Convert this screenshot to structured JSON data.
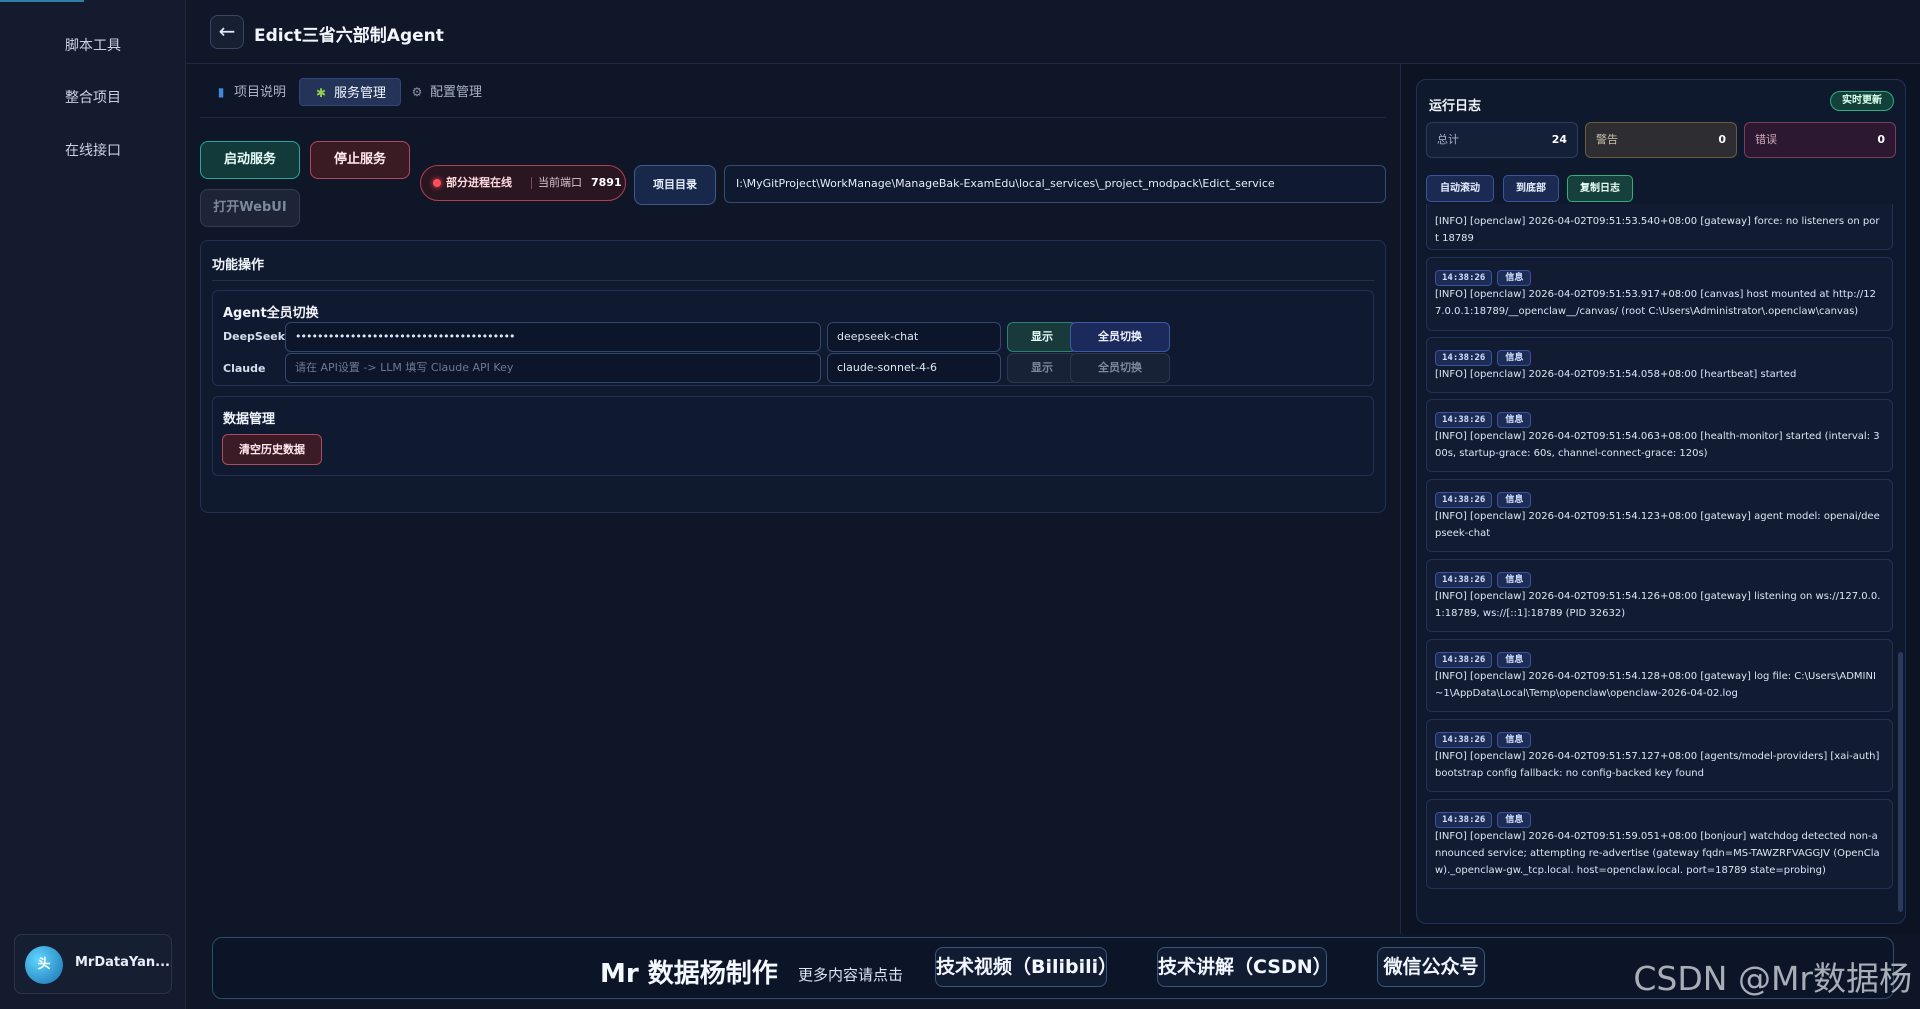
{
  "sidebar": {
    "items": [
      {
        "label": "脚本工具"
      },
      {
        "label": "整合项目"
      },
      {
        "label": "在线接口"
      }
    ],
    "user": {
      "avatar_text": "头",
      "name": "MrDataYan..."
    }
  },
  "header": {
    "back_icon": "←",
    "title": "Edict三省六部制Agent"
  },
  "tabs": [
    {
      "label": "项目说明",
      "icon": "book-icon",
      "active": false
    },
    {
      "label": "服务管理",
      "icon": "puzzle-icon",
      "active": true
    },
    {
      "label": "配置管理",
      "icon": "gear-icon",
      "active": false
    }
  ],
  "service": {
    "start_label": "启动服务",
    "stop_label": "停止服务",
    "webui_label": "打开WebUI",
    "status_text": "部分进程在线",
    "port_label": "当前端口",
    "port_value": "7891",
    "projdir_label": "项目目录",
    "path": "I:\\MyGitProject\\WorkManage\\ManageBak-ExamEdu\\local_services\\_project_modpack\\Edict_service"
  },
  "functions": {
    "title": "功能操作",
    "agent": {
      "title": "Agent全员切换",
      "rows": [
        {
          "label": "DeepSeek",
          "key_value": "••••••••••••••••••••••••••••••••••••••••",
          "key_placeholder": "",
          "model": "deepseek-chat",
          "show_label": "显示",
          "switch_label": "全员切换",
          "enabled": true
        },
        {
          "label": "Claude",
          "key_value": "",
          "key_placeholder": "请在 API设置 -> LLM 填写 Claude API Key",
          "model": "claude-sonnet-4-6",
          "show_label": "显示",
          "switch_label": "全员切换",
          "enabled": false
        }
      ]
    },
    "data": {
      "title": "数据管理",
      "clear_label": "清空历史数据"
    }
  },
  "log": {
    "title": "运行日志",
    "live_badge": "实时更新",
    "stats": {
      "total_label": "总计",
      "total": "24",
      "warn_label": "警告",
      "warn": "0",
      "error_label": "错误",
      "error": "0"
    },
    "buttons": {
      "auto_scroll": "自动滚动",
      "to_bottom": "到底部",
      "copy": "复制日志"
    },
    "entries": [
      {
        "time": "",
        "level": "",
        "msg": "[INFO] [openclaw] 2026-04-02T09:51:53.540+08:00 [gateway] force: no listeners on port 18789"
      },
      {
        "time": "14:38:26",
        "level": "信息",
        "msg": "[INFO] [openclaw] 2026-04-02T09:51:53.917+08:00 [canvas] host mounted at http://127.0.0.1:18789/__openclaw__/canvas/ (root C:\\Users\\Administrator\\.openclaw\\canvas)"
      },
      {
        "time": "14:38:26",
        "level": "信息",
        "msg": "[INFO] [openclaw] 2026-04-02T09:51:54.058+08:00 [heartbeat] started"
      },
      {
        "time": "14:38:26",
        "level": "信息",
        "msg": "[INFO] [openclaw] 2026-04-02T09:51:54.063+08:00 [health-monitor] started (interval: 300s, startup-grace: 60s, channel-connect-grace: 120s)"
      },
      {
        "time": "14:38:26",
        "level": "信息",
        "msg": "[INFO] [openclaw] 2026-04-02T09:51:54.123+08:00 [gateway] agent model: openai/deepseek-chat"
      },
      {
        "time": "14:38:26",
        "level": "信息",
        "msg": "[INFO] [openclaw] 2026-04-02T09:51:54.126+08:00 [gateway] listening on ws://127.0.0.1:18789, ws://[::1]:18789 (PID 32632)"
      },
      {
        "time": "14:38:26",
        "level": "信息",
        "msg": "[INFO] [openclaw] 2026-04-02T09:51:54.128+08:00 [gateway] log file: C:\\Users\\ADMINI~1\\AppData\\Local\\Temp\\openclaw\\openclaw-2026-04-02.log"
      },
      {
        "time": "14:38:26",
        "level": "信息",
        "msg": "[INFO] [openclaw] 2026-04-02T09:51:57.127+08:00 [agents/model-providers] [xai-auth] bootstrap config fallback: no config-backed key found"
      },
      {
        "time": "14:38:26",
        "level": "信息",
        "msg": "[INFO] [openclaw] 2026-04-02T09:51:59.051+08:00 [bonjour] watchdog detected non-announced service; attempting re-advertise (gateway fqdn=MS-TAWZRFVAGGJV (OpenClaw)._openclaw-gw._tcp.local. host=openclaw.local. port=18789 state=probing)"
      }
    ]
  },
  "footer": {
    "brand": "Mr 数据杨制作",
    "more": "更多内容请点击",
    "links": [
      "技术视频（Bilibili）",
      "技术讲解（CSDN）",
      "微信公众号"
    ]
  },
  "watermark": "CSDN @Mr数据杨",
  "colors": {
    "accent": "#3c59a6",
    "success": "#2aa897",
    "danger": "#b04a5d"
  }
}
